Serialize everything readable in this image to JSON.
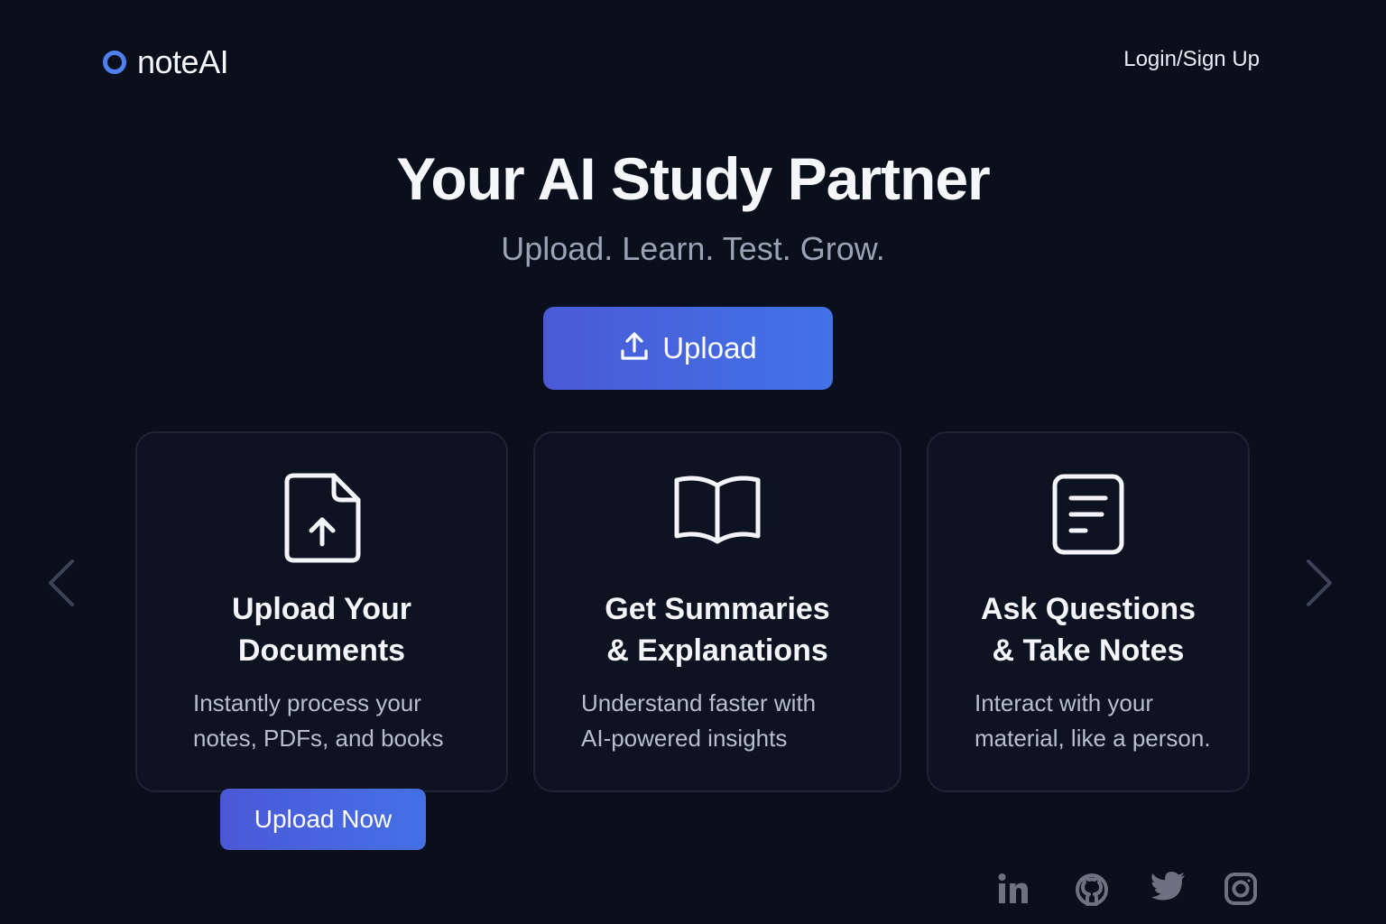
{
  "header": {
    "logo_text": "noteAI",
    "login_label": "Login/Sign Up"
  },
  "hero": {
    "title": "Your AI Study Partner",
    "subtitle": "Upload. Learn. Test. Grow.",
    "upload_label": "Upload",
    "upload_icon": "upload-icon"
  },
  "features": [
    {
      "icon": "file-upload-icon",
      "title_line1": "Upload Your",
      "title_line2": "Documents",
      "desc_line1": "Instantly process your",
      "desc_line2": "notes, PDFs, and books"
    },
    {
      "icon": "book-icon",
      "title_line1": "Get Summaries",
      "title_line2": "& Explanations",
      "desc_line1": "Understand faster with",
      "desc_line2": "AI-powered insights"
    },
    {
      "icon": "notes-icon",
      "title_line1": "Ask Questions",
      "title_line2": "& Take Notes",
      "desc_line1": "Interact with your",
      "desc_line2": "material, like a person."
    }
  ],
  "upload_now_label": "Upload Now",
  "carousel": {
    "prev_icon": "chevron-left-icon",
    "next_icon": "chevron-right-icon"
  },
  "social": [
    "linkedin-icon",
    "github-icon",
    "twitter-icon",
    "instagram-icon"
  ],
  "colors": {
    "background": "#0a0f1c",
    "accent": "#4f7ff0",
    "button_gradient_start": "#4a5ad6",
    "button_gradient_end": "#4172e6"
  }
}
